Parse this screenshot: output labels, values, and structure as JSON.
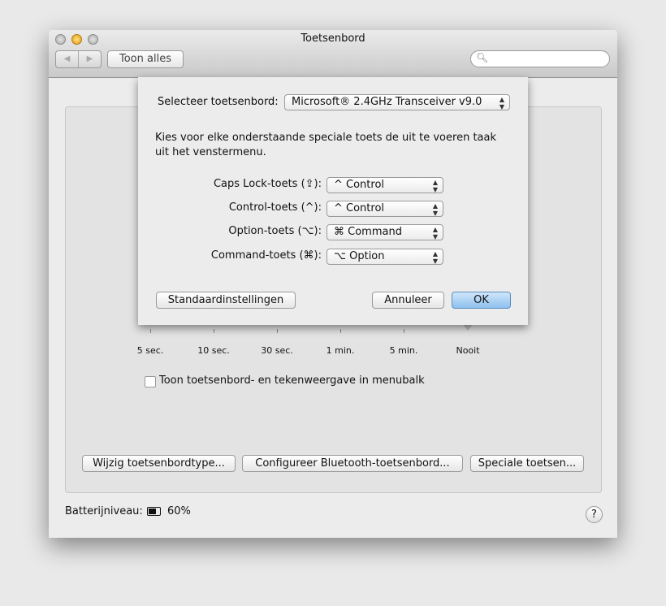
{
  "window": {
    "title": "Toetsenbord",
    "show_all": "Toon alles",
    "search_placeholder": "",
    "back": "◀",
    "forward": "▶"
  },
  "slider": {
    "labels": [
      "5 sec.",
      "10 sec.",
      "30 sec.",
      "1 min.",
      "5 min.",
      "Nooit"
    ],
    "value": "Nooit"
  },
  "menubar_checkbox": {
    "label": "Toon toetsenbord- en tekenweergave in menubalk",
    "checked": false
  },
  "buttons": {
    "change_type": "Wijzig toetsenbordtype...",
    "bluetooth": "Configureer Bluetooth-toetsenbord...",
    "special": "Speciale toetsen..."
  },
  "battery": {
    "label": "Batterijniveau:",
    "value": "60%",
    "level": 0.6
  },
  "help": "?",
  "sheet": {
    "select_label": "Selecteer toetsenbord:",
    "keyboard": "Microsoft® 2.4GHz Transceiver v9.0",
    "instructions": "Kies voor elke onderstaande speciale toets de uit te voeren taak uit het venstermenu.",
    "rows": [
      {
        "label": "Caps Lock-toets (⇪):",
        "value": "^ Control"
      },
      {
        "label": "Control-toets (^):",
        "value": "^ Control"
      },
      {
        "label": "Option-toets (⌥):",
        "value": "⌘ Command"
      },
      {
        "label": "Command-toets (⌘):",
        "value": "⌥ Option"
      }
    ],
    "defaults": "Standaardinstellingen",
    "cancel": "Annuleer",
    "ok": "OK"
  },
  "colors": {
    "ok_button": "#9cc8f0",
    "minimize": "#f0b030"
  }
}
